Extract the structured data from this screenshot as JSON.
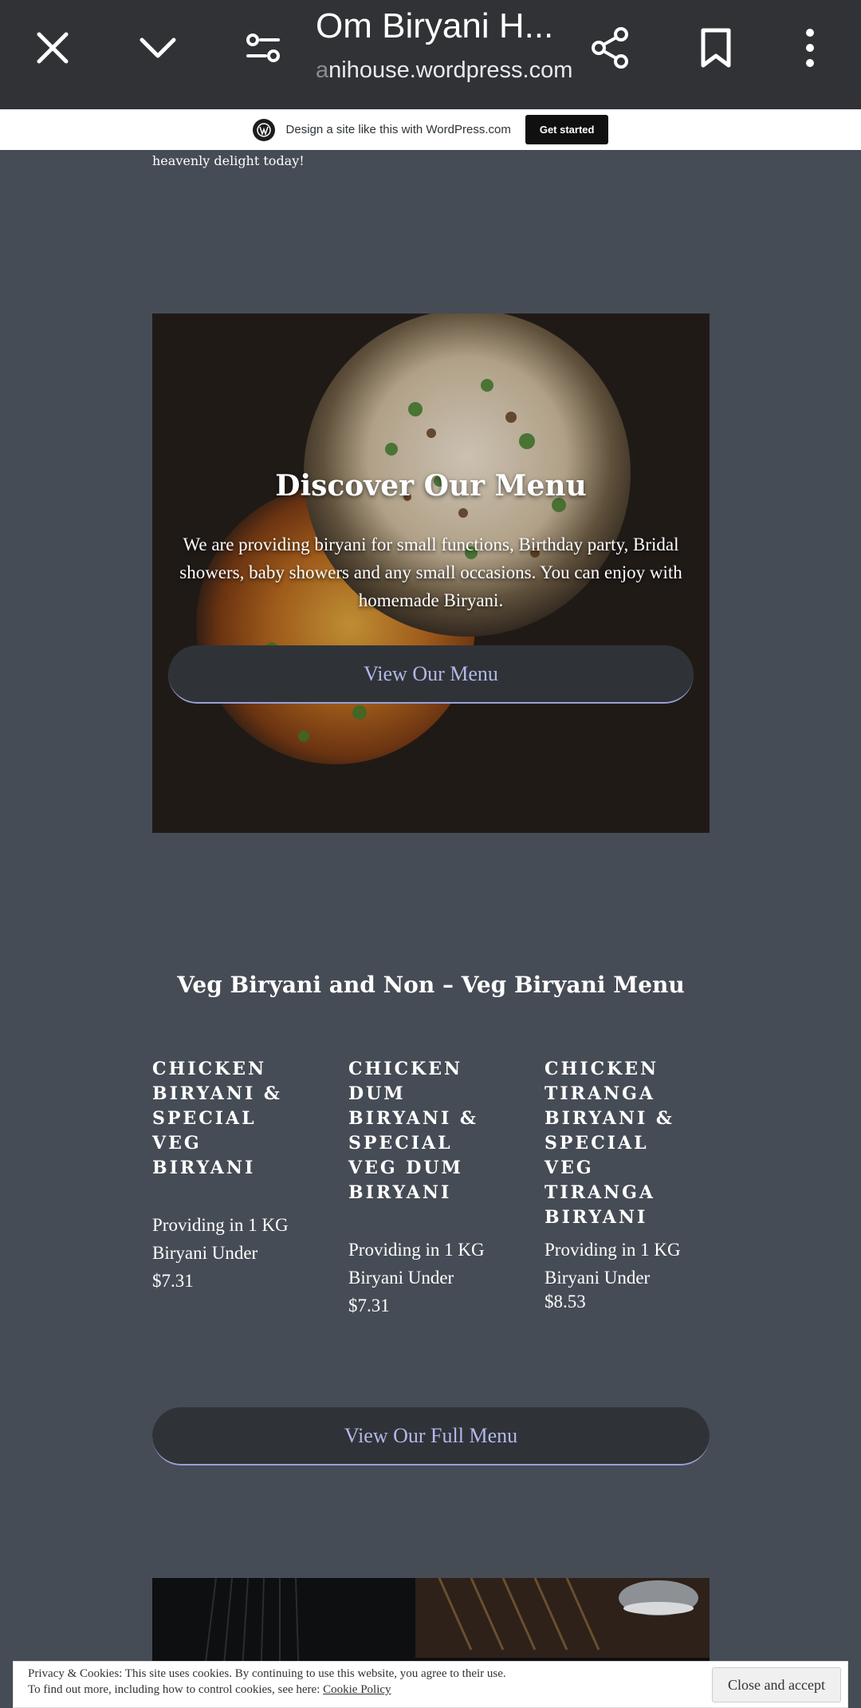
{
  "browser": {
    "title": "Om Biryani H...",
    "url_fade": "a",
    "url": "nihouse.wordpress.com"
  },
  "wp_banner": {
    "text": "Design a site like this with WordPress.com",
    "button": "Get started"
  },
  "intro": {
    "tail": "heavenly delight today!"
  },
  "hero": {
    "title": "Discover Our Menu",
    "text": "We are providing biryani for small functions, Birthday party, Bridal showers, baby showers and any small occasions. You can enjoy with homemade Biryani.",
    "button": "View Our Menu"
  },
  "menu": {
    "title": "Veg Biryani and Non – Veg Biryani Menu",
    "items": [
      {
        "name": "CHICKEN BIRYANI & SPECIAL VEG BIRYANI",
        "desc": "Providing in 1 KG Biryani Under",
        "price": "$7.31"
      },
      {
        "name": "CHICKEN DUM BIRYANI & SPECIAL VEG DUM BIRYANI",
        "desc": "Providing in 1 KG Biryani Under",
        "price": "$7.31"
      },
      {
        "name": "CHICKEN TIRANGA BIRYANI & SPECIAL VEG TIRANGA BIRYANI",
        "desc": "Providing in 1 KG Biryani Under",
        "price": "$8.53"
      }
    ],
    "full_button": "View Our Full Menu"
  },
  "cookie": {
    "line1": "Privacy & Cookies: This site uses cookies. By continuing to use this website, you agree to their use.",
    "line2": "To find out more, including how to control cookies, see here:",
    "link": "Cookie Policy",
    "button": "Close and accept"
  },
  "icons": [
    "close-icon",
    "chevron-down-icon",
    "page-settings-icon",
    "share-icon",
    "bookmark-icon",
    "more-vert-icon",
    "wordpress-logo-icon"
  ]
}
